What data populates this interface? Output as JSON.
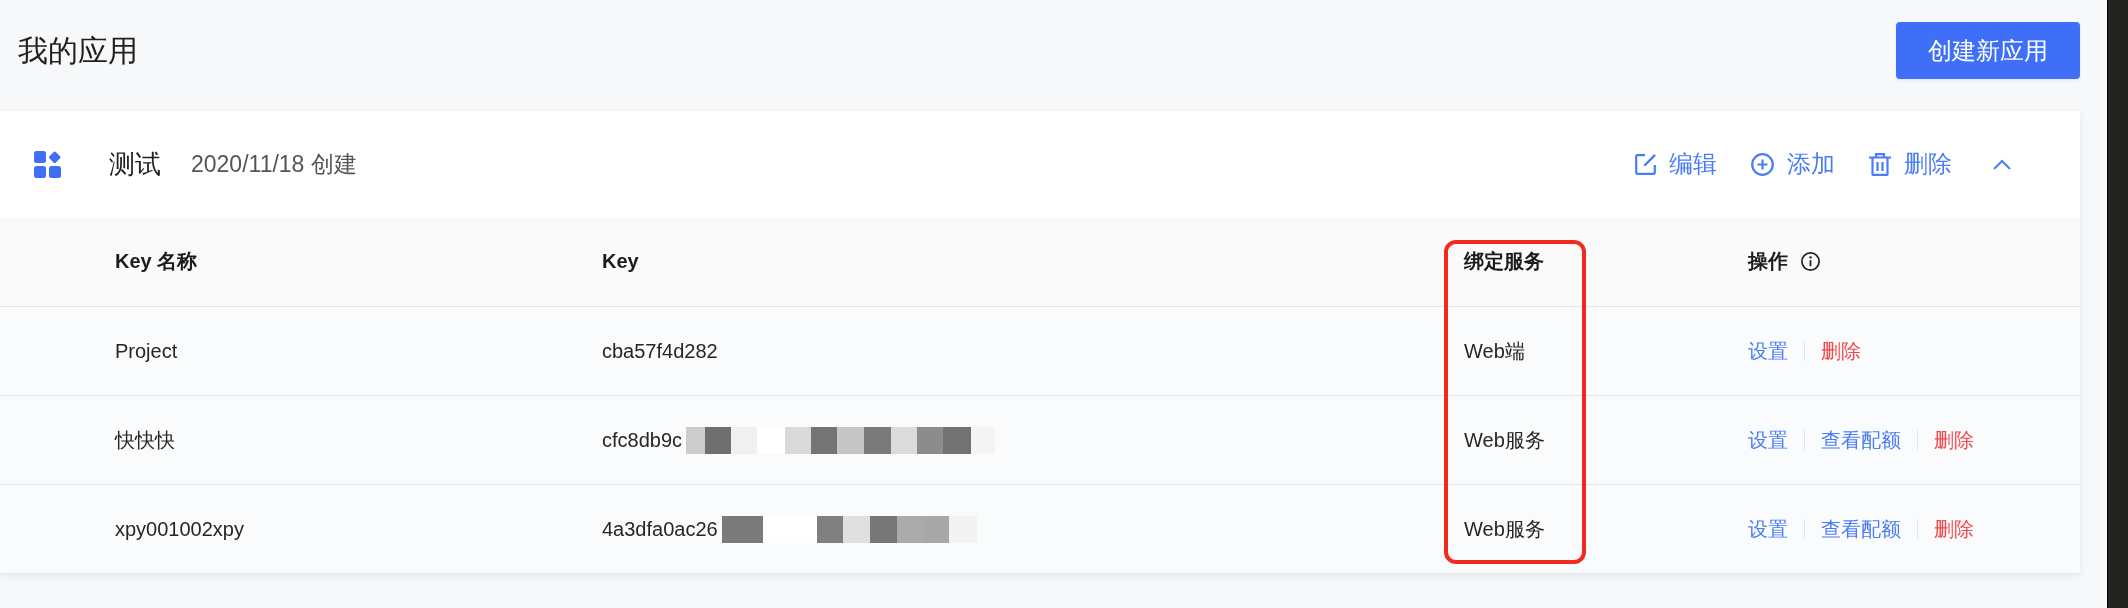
{
  "page": {
    "title": "我的应用",
    "create_button": "创建新应用"
  },
  "app": {
    "name": "测试",
    "created": "2020/11/18 创建",
    "expanded": true,
    "actions": [
      {
        "kind": "edit",
        "label": "编辑"
      },
      {
        "kind": "add",
        "label": "添加"
      },
      {
        "kind": "delete",
        "label": "删除"
      }
    ]
  },
  "table": {
    "columns": [
      {
        "label": "Key 名称",
        "highlighted": false,
        "info": false
      },
      {
        "label": "Key",
        "highlighted": false,
        "info": false
      },
      {
        "label": "绑定服务",
        "highlighted": true,
        "info": false
      },
      {
        "label": "操作",
        "highlighted": false,
        "info": true
      }
    ],
    "rows": [
      {
        "name": "Project",
        "key": "cba57f4d282",
        "redacted": false,
        "service": "Web端",
        "actions": [
          {
            "kind": "link",
            "label": "设置"
          },
          {
            "kind": "danger",
            "label": "删除"
          }
        ]
      },
      {
        "name": "快快快",
        "key": "cfc8db9c",
        "redacted": true,
        "service": "Web服务",
        "actions": [
          {
            "kind": "link",
            "label": "设置"
          },
          {
            "kind": "link",
            "label": "查看配额"
          },
          {
            "kind": "danger",
            "label": "删除"
          }
        ]
      },
      {
        "name": "xpy001002xpy",
        "key": "4a3dfa0ac26",
        "redacted": true,
        "service": "Web服务",
        "actions": [
          {
            "kind": "link",
            "label": "设置"
          },
          {
            "kind": "link",
            "label": "查看配额"
          },
          {
            "kind": "danger",
            "label": "删除"
          }
        ]
      }
    ]
  }
}
